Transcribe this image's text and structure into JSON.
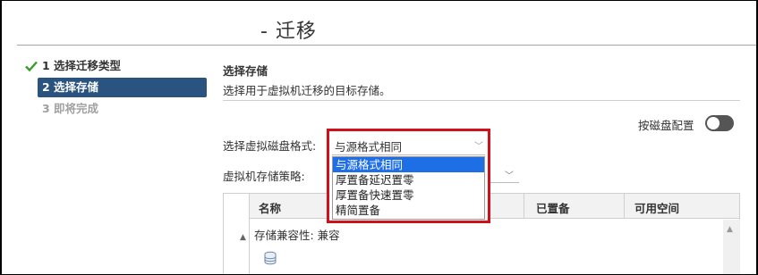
{
  "header": {
    "title": "- 迁移"
  },
  "steps": [
    {
      "label": "1 选择迁移类型",
      "status": "completed"
    },
    {
      "label": "2 选择存储",
      "status": "active"
    },
    {
      "label": "3 即将完成",
      "status": "pending"
    }
  ],
  "section": {
    "heading": "选择存储",
    "description": "选择用于虚拟机迁移的目标存储。"
  },
  "toggle": {
    "label": "按磁盘配置",
    "state": "off"
  },
  "disk_format": {
    "label": "选择虚拟磁盘格式:",
    "selected": "与源格式相同",
    "options": [
      "与源格式相同",
      "厚置备延迟置零",
      "厚置备快速置零",
      "精简置备"
    ]
  },
  "storage_policy": {
    "label": "虚拟机存储策略:"
  },
  "table": {
    "columns": [
      "名称",
      "已置备",
      "可用空间"
    ],
    "group_label": "存储兼容性: 兼容"
  },
  "colors": {
    "active_step": "#2b5380",
    "highlight_border": "#d0101b",
    "selected_option": "#1e6ee6",
    "check": "#3a9a2a"
  },
  "icons": [
    "checkmark-icon",
    "toggle-switch",
    "chevron-down-icon",
    "expand-triangle-icon",
    "database-icon",
    "scroll-up-icon"
  ]
}
